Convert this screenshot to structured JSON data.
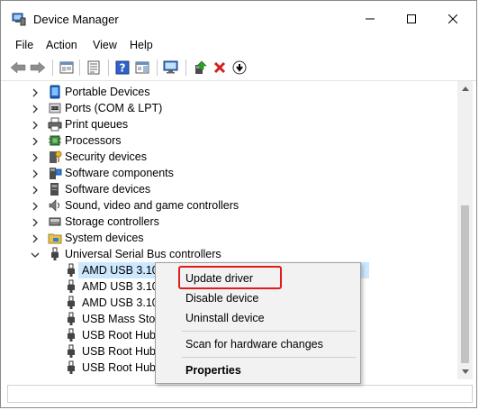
{
  "window": {
    "title": "Device Manager"
  },
  "menu": [
    "File",
    "Action",
    "View",
    "Help"
  ],
  "tree": {
    "categories": [
      {
        "label": "Portable Devices",
        "icon": "portable-device-icon",
        "expanded": false
      },
      {
        "label": "Ports (COM & LPT)",
        "icon": "port-icon",
        "expanded": false
      },
      {
        "label": "Print queues",
        "icon": "printer-icon",
        "expanded": false
      },
      {
        "label": "Processors",
        "icon": "processor-icon",
        "expanded": false
      },
      {
        "label": "Security devices",
        "icon": "security-key-icon",
        "expanded": false
      },
      {
        "label": "Software components",
        "icon": "software-component-icon",
        "expanded": false
      },
      {
        "label": "Software devices",
        "icon": "software-device-icon",
        "expanded": false
      },
      {
        "label": "Sound, video and game controllers",
        "icon": "speaker-icon",
        "expanded": false
      },
      {
        "label": "Storage controllers",
        "icon": "storage-controller-icon",
        "expanded": false
      },
      {
        "label": "System devices",
        "icon": "system-folder-icon",
        "expanded": false
      },
      {
        "label": "Universal Serial Bus controllers",
        "icon": "usb-connector-icon",
        "expanded": true
      }
    ],
    "usb_children": [
      {
        "label": "AMD USB 3.10",
        "selected": true
      },
      {
        "label": "AMD USB 3.10",
        "selected": false
      },
      {
        "label": "AMD USB 3.10",
        "selected": false
      },
      {
        "label": "USB Mass Stora",
        "selected": false
      },
      {
        "label": "USB Root Hub",
        "selected": false
      },
      {
        "label": "USB Root Hub",
        "selected": false
      },
      {
        "label": "USB Root Hub",
        "selected": false
      }
    ]
  },
  "context_menu": {
    "update_driver": "Update driver",
    "disable_device": "Disable device",
    "uninstall_device": "Uninstall device",
    "scan_hardware": "Scan for hardware changes",
    "properties": "Properties",
    "highlight_color": "#e21b1b"
  },
  "colors": {
    "selection": "#cce8ff",
    "menu_background": "#f2f2f2",
    "remove_red": "#d81e1e",
    "help_blue": "#2f62c8"
  }
}
